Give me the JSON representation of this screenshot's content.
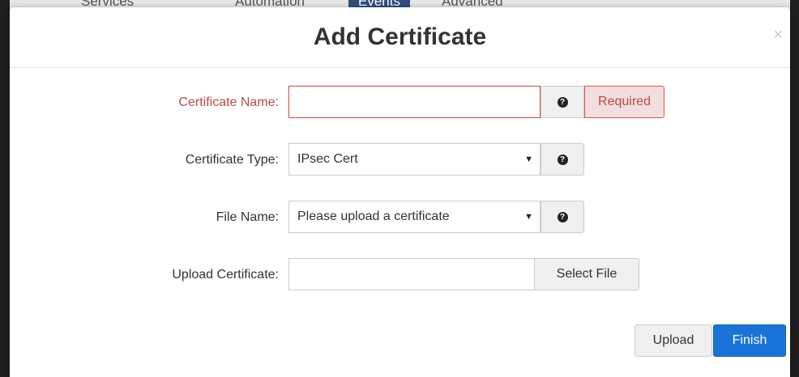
{
  "background_nav": {
    "items": [
      "Services",
      "Automation",
      "Events",
      "Advanced"
    ],
    "active_index": 2
  },
  "modal": {
    "title": "Add Certificate",
    "close_label": "×"
  },
  "form": {
    "certificate_name": {
      "label": "Certificate Name:",
      "value": "",
      "help_icon": "?",
      "status": "Required"
    },
    "certificate_type": {
      "label": "Certificate Type:",
      "selected": "IPsec Cert",
      "help_icon": "?"
    },
    "file_name": {
      "label": "File Name:",
      "selected": "Please upload a certificate",
      "help_icon": "?"
    },
    "upload_certificate": {
      "label": "Upload Certificate:",
      "value": "",
      "button": "Select File"
    }
  },
  "footer": {
    "upload_label": "Upload",
    "finish_label": "Finish"
  },
  "colors": {
    "error": "#b94a48",
    "primary": "#1a73d8"
  }
}
